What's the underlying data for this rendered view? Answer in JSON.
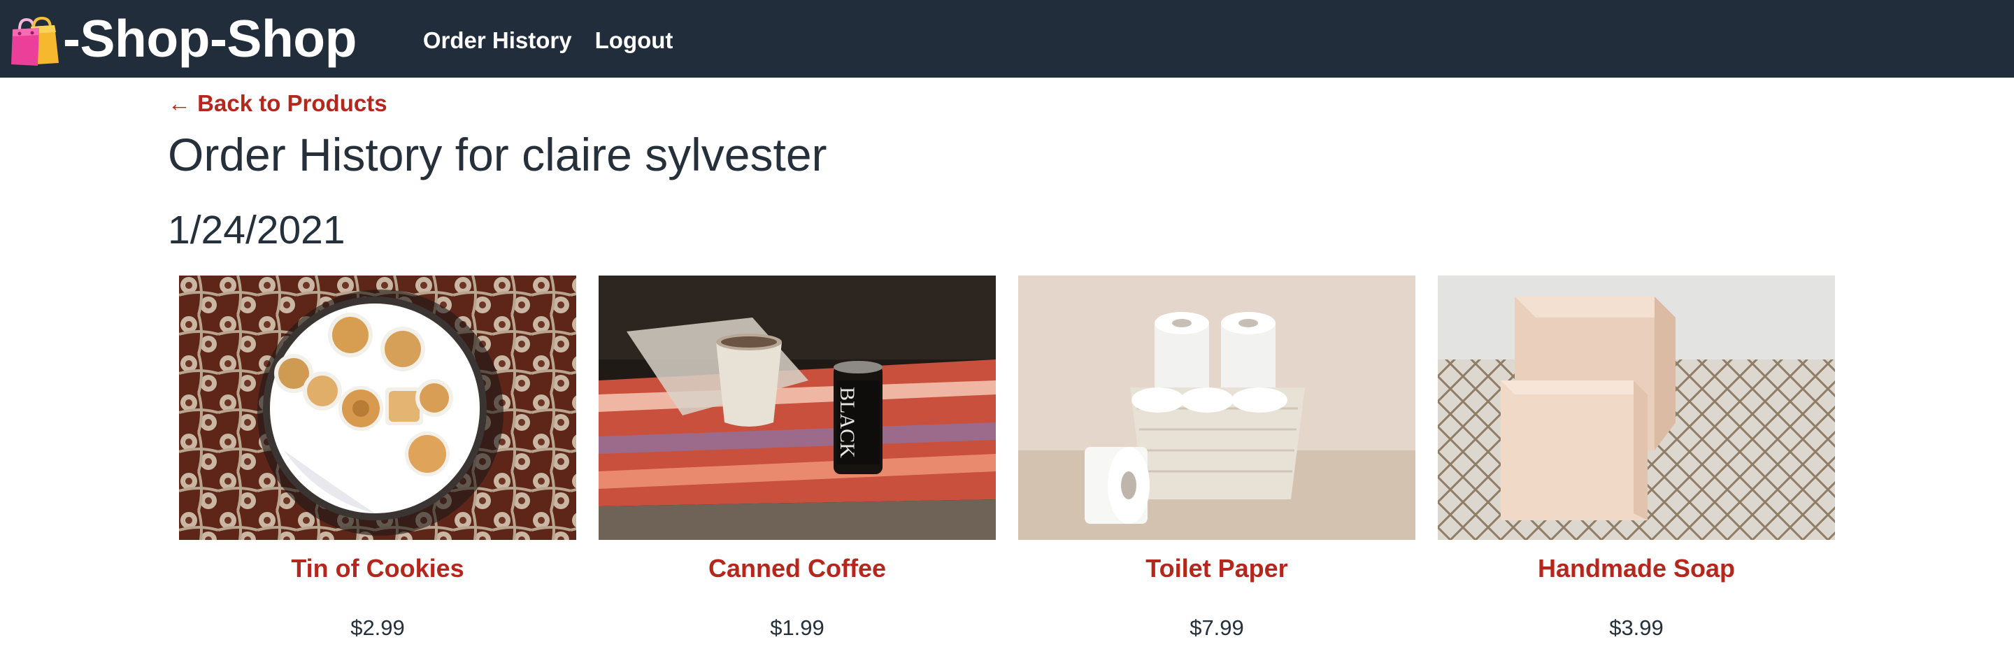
{
  "header": {
    "brand_text": "-Shop-Shop",
    "logo_icon": "shopping-bags-icon",
    "nav": [
      {
        "label": "Order History"
      },
      {
        "label": "Logout"
      }
    ]
  },
  "main": {
    "back_link": "← Back to Products",
    "title": "Order History for claire sylvester",
    "order": {
      "date": "1/24/2021",
      "items": [
        {
          "name": "Tin of Cookies",
          "price": "$2.99",
          "image_icon": "cookies-tin-photo"
        },
        {
          "name": "Canned Coffee",
          "price": "$1.99",
          "image_icon": "canned-coffee-photo"
        },
        {
          "name": "Toilet Paper",
          "price": "$7.99",
          "image_icon": "toilet-paper-photo"
        },
        {
          "name": "Handmade Soap",
          "price": "$3.99",
          "image_icon": "handmade-soap-photo"
        }
      ]
    }
  },
  "colors": {
    "navbar_bg": "#212d3b",
    "accent_red": "#b5271c",
    "text_dark": "#26303b"
  }
}
